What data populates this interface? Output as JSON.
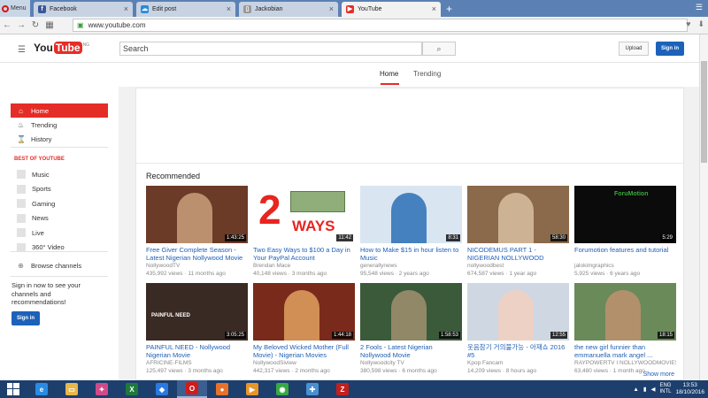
{
  "browser": {
    "menu_label": "Menu",
    "tabs": [
      {
        "title": "Facebook",
        "icon": "facebook-icon",
        "color": "#3b5998",
        "glyph": "f"
      },
      {
        "title": "Edit post",
        "icon": "edit-post-icon",
        "color": "#2b8bd6",
        "glyph": "☁"
      },
      {
        "title": "Jackobian",
        "icon": "blogger-page-icon",
        "color": "#999999",
        "glyph": "▯"
      },
      {
        "title": "YouTube",
        "icon": "youtube-icon",
        "color": "#e52d27",
        "glyph": "▶"
      }
    ],
    "url": "www.youtube.com"
  },
  "youtube": {
    "logo_you": "You",
    "logo_tube": "Tube",
    "logo_region": "NG",
    "search_placeholder": "Search",
    "upload_label": "Upload",
    "signin_label": "Sign in",
    "nav": [
      {
        "label": "Home",
        "icon": "home-icon",
        "glyph": "⌂"
      },
      {
        "label": "Trending",
        "icon": "trending-flame-icon",
        "glyph": "♨"
      },
      {
        "label": "History",
        "icon": "history-icon",
        "glyph": "⌛"
      }
    ],
    "best_of_heading": "BEST OF YOUTUBE",
    "best_of": [
      "Music",
      "Sports",
      "Gaming",
      "News",
      "Live",
      "360° Video"
    ],
    "browse_channels": "Browse channels",
    "signin_prompt": "Sign in now to see your channels and recommendations!",
    "sidebar_signin": "Sign in",
    "feed_tabs": [
      "Home",
      "Trending"
    ],
    "recommended_title": "Recommended",
    "show_more": "Show more",
    "videos": [
      {
        "title": "Free Giver Complete Season - Latest Nigerian Nollywood Movie",
        "channel": "NollywoodTV",
        "views": "435,992 views",
        "age": "11 months ago",
        "duration": "1:43:25",
        "bg": "#6b3b28",
        "accent": "#c9a07a"
      },
      {
        "title": "Two Easy Ways to $100 a Day in Your PayPal Account",
        "channel": "Brendan Mace",
        "views": "40,148 views",
        "age": "3 months ago",
        "duration": "11:42",
        "bg": "#ffffff",
        "accent": "#e8241f",
        "overlay_big": "2",
        "overlay_small": "WAYS"
      },
      {
        "title": "How to Make $15 in hour listen to Music",
        "channel": "generallynews",
        "views": "95,548 views",
        "age": "2 years ago",
        "duration": "8:31",
        "bg": "#d9e6f2",
        "accent": "#2a6fb5"
      },
      {
        "title": "NICODEMUS PART 1 - NIGERIAN NOLLYWOOD COMEDY MOVIE",
        "channel": "nollywoodbest",
        "views": "674,587 views",
        "age": "1 year ago",
        "duration": "58:30",
        "bg": "#8a6a4a",
        "accent": "#d8c0a0"
      },
      {
        "title": "Forumotion features and tutorial",
        "channel": "jalokimgraphics",
        "views": "5,925 views",
        "age": "6 years ago",
        "duration": "5:29",
        "bg": "#0b0b0b",
        "accent": "#3aa83a",
        "overlay_big": "ForuMotion"
      },
      {
        "title": "PAINFUL NEED - Nollywood Nigerian Movie",
        "channel": "AFRICINE-FILMS",
        "views": "125,497 views",
        "age": "3 months ago",
        "duration": "3:05:25",
        "bg": "#3a2a24",
        "accent": "#b58a6a",
        "overlay_big": "PAINFUL NEED"
      },
      {
        "title": "My Beloved Wicked Mother (Full Movie) - Nigerian Movies",
        "channel": "NollywoodSiview",
        "views": "442,317 views",
        "age": "2 months ago",
        "duration": "1:44:18",
        "bg": "#7a2a1a",
        "accent": "#e0a060"
      },
      {
        "title": "2 Fools - Latest Nigerian Nollywood Movie",
        "channel": "Nollywoodcity TV",
        "views": "380,598 views",
        "age": "6 months ago",
        "duration": "1:58:53",
        "bg": "#3a5a3a",
        "accent": "#a09070"
      },
      {
        "title": "웃음참기 거의불가능 - 아재쇼 2016 #5",
        "channel": "Kpop Fancam",
        "views": "14,209 views",
        "age": "8 hours ago",
        "duration": "12:55",
        "bg": "#cfd8e2",
        "accent": "#f2d0c0"
      },
      {
        "title": "the new girl funnier than emmanuella mark angel ...",
        "channel": "RAYPOWERTV I NOLLYWOODMOVIES",
        "views": "63,480 views",
        "age": "1 month ago",
        "duration": "18:15",
        "bg": "#6a8a5a",
        "accent": "#c09070"
      }
    ]
  },
  "taskbar": {
    "apps": [
      {
        "name": "ie-icon",
        "glyph": "e",
        "color": "#2a8be0"
      },
      {
        "name": "file-explorer-icon",
        "glyph": "▭",
        "color": "#e8b84a"
      },
      {
        "name": "photo-app-icon",
        "glyph": "✦",
        "color": "#d04a8a"
      },
      {
        "name": "excel-icon",
        "glyph": "X",
        "color": "#1e7a3c"
      },
      {
        "name": "dropbox-icon",
        "glyph": "◆",
        "color": "#2a7ae0"
      },
      {
        "name": "opera-icon",
        "glyph": "O",
        "color": "#d11a1a"
      },
      {
        "name": "firefox-icon",
        "glyph": "●",
        "color": "#e8722a"
      },
      {
        "name": "media-player-icon",
        "glyph": "▶",
        "color": "#e8962a"
      },
      {
        "name": "chrome-icon",
        "glyph": "◉",
        "color": "#3aa845"
      },
      {
        "name": "network-globe-icon",
        "glyph": "✚",
        "color": "#4a90d0"
      },
      {
        "name": "filezilla-icon",
        "glyph": "Z",
        "color": "#c41e1e"
      }
    ],
    "lang_top": "ENG",
    "lang_bottom": "INTL",
    "time": "13:53",
    "date": "18/10/2016"
  }
}
